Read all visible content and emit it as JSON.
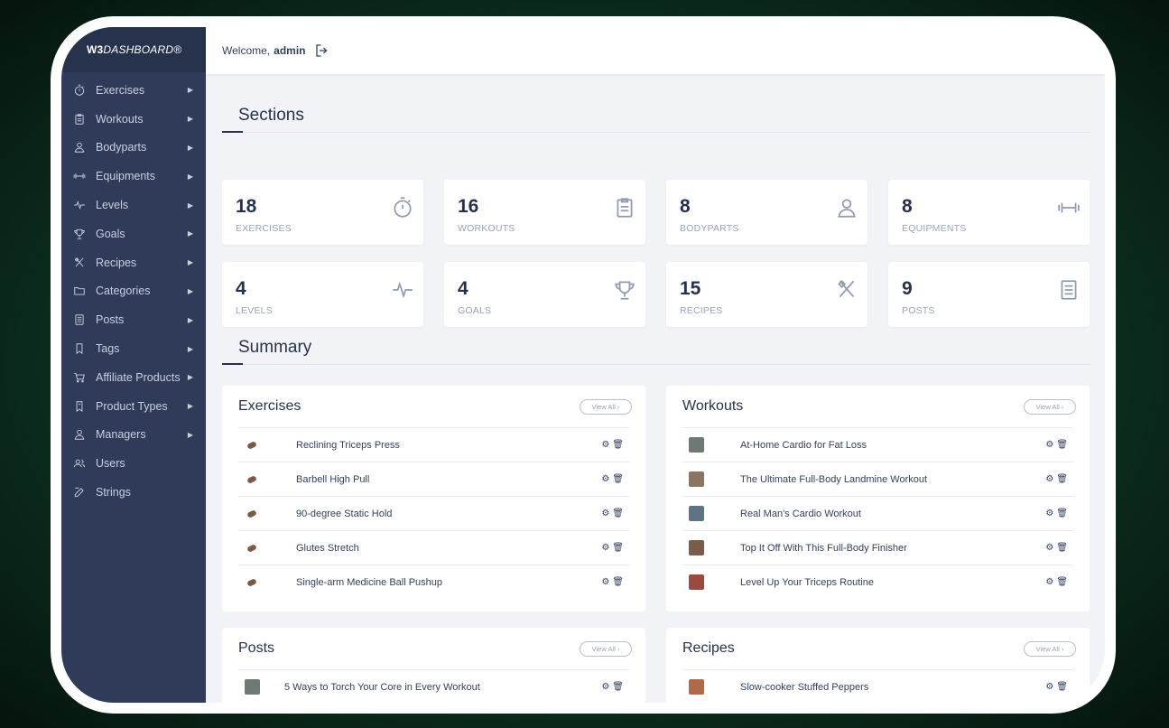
{
  "brand": {
    "prefix": "W3",
    "name": "DASHBOARD®"
  },
  "sidebar": {
    "items": [
      {
        "label": "Exercises",
        "icon": "stopwatch-icon",
        "chevron": true
      },
      {
        "label": "Workouts",
        "icon": "clipboard-icon",
        "chevron": true
      },
      {
        "label": "Bodyparts",
        "icon": "person-icon",
        "chevron": true
      },
      {
        "label": "Equipments",
        "icon": "dumbbell-icon",
        "chevron": true
      },
      {
        "label": "Levels",
        "icon": "pulse-icon",
        "chevron": true
      },
      {
        "label": "Goals",
        "icon": "trophy-icon",
        "chevron": true
      },
      {
        "label": "Recipes",
        "icon": "utensils-icon",
        "chevron": true
      },
      {
        "label": "Categories",
        "icon": "folder-icon",
        "chevron": true
      },
      {
        "label": "Posts",
        "icon": "document-icon",
        "chevron": true
      },
      {
        "label": "Tags",
        "icon": "bookmark-icon",
        "chevron": true
      },
      {
        "label": "Affiliate Products",
        "icon": "cart-icon",
        "chevron": true
      },
      {
        "label": "Product Types",
        "icon": "tag-icon",
        "chevron": true
      },
      {
        "label": "Managers",
        "icon": "person-icon",
        "chevron": true
      },
      {
        "label": "Users",
        "icon": "users-icon",
        "chevron": false
      },
      {
        "label": "Strings",
        "icon": "edit-icon",
        "chevron": false
      }
    ],
    "chevron_glyph": "▶"
  },
  "header": {
    "welcome": "Welcome,",
    "username": "admin"
  },
  "sections": {
    "title": "Sections",
    "cards": [
      {
        "count": "18",
        "label": "EXERCISES",
        "icon": "stopwatch-icon"
      },
      {
        "count": "16",
        "label": "WORKOUTS",
        "icon": "clipboard-icon"
      },
      {
        "count": "8",
        "label": "BODYPARTS",
        "icon": "person-icon"
      },
      {
        "count": "8",
        "label": "EQUIPMENTS",
        "icon": "dumbbell-icon"
      },
      {
        "count": "4",
        "label": "LEVELS",
        "icon": "pulse-icon"
      },
      {
        "count": "4",
        "label": "GOALS",
        "icon": "trophy-icon"
      },
      {
        "count": "15",
        "label": "RECIPES",
        "icon": "utensils-icon"
      },
      {
        "count": "9",
        "label": "POSTS",
        "icon": "document-icon"
      }
    ]
  },
  "summary": {
    "title": "Summary",
    "view_all": "View All  ›",
    "exercises": {
      "title": "Exercises",
      "items": [
        "Reclining Triceps Press",
        "Barbell High Pull",
        "90-degree Static Hold",
        "Glutes Stretch",
        "Single-arm Medicine Ball Pushup"
      ]
    },
    "workouts": {
      "title": "Workouts",
      "items": [
        "At-Home Cardio for Fat Loss",
        "The Ultimate Full-Body Landmine Workout",
        "Real Man's Cardio Workout",
        "Top It Off With This Full-Body Finisher",
        "Level Up Your Triceps Routine"
      ]
    },
    "posts": {
      "title": "Posts",
      "items": [
        "5 Ways to Torch Your Core in Every Workout"
      ]
    },
    "recipes": {
      "title": "Recipes",
      "items": [
        "Slow-cooker Stuffed Peppers"
      ]
    }
  },
  "actions": {
    "edit_glyph": "⚙",
    "delete_glyph": "🗑"
  },
  "colors": {
    "sidebar": "#2f3b59",
    "brand_bar": "#27324c",
    "text_dark": "#26324b",
    "muted": "#9aa3b5",
    "background": "#f1f3f7"
  }
}
